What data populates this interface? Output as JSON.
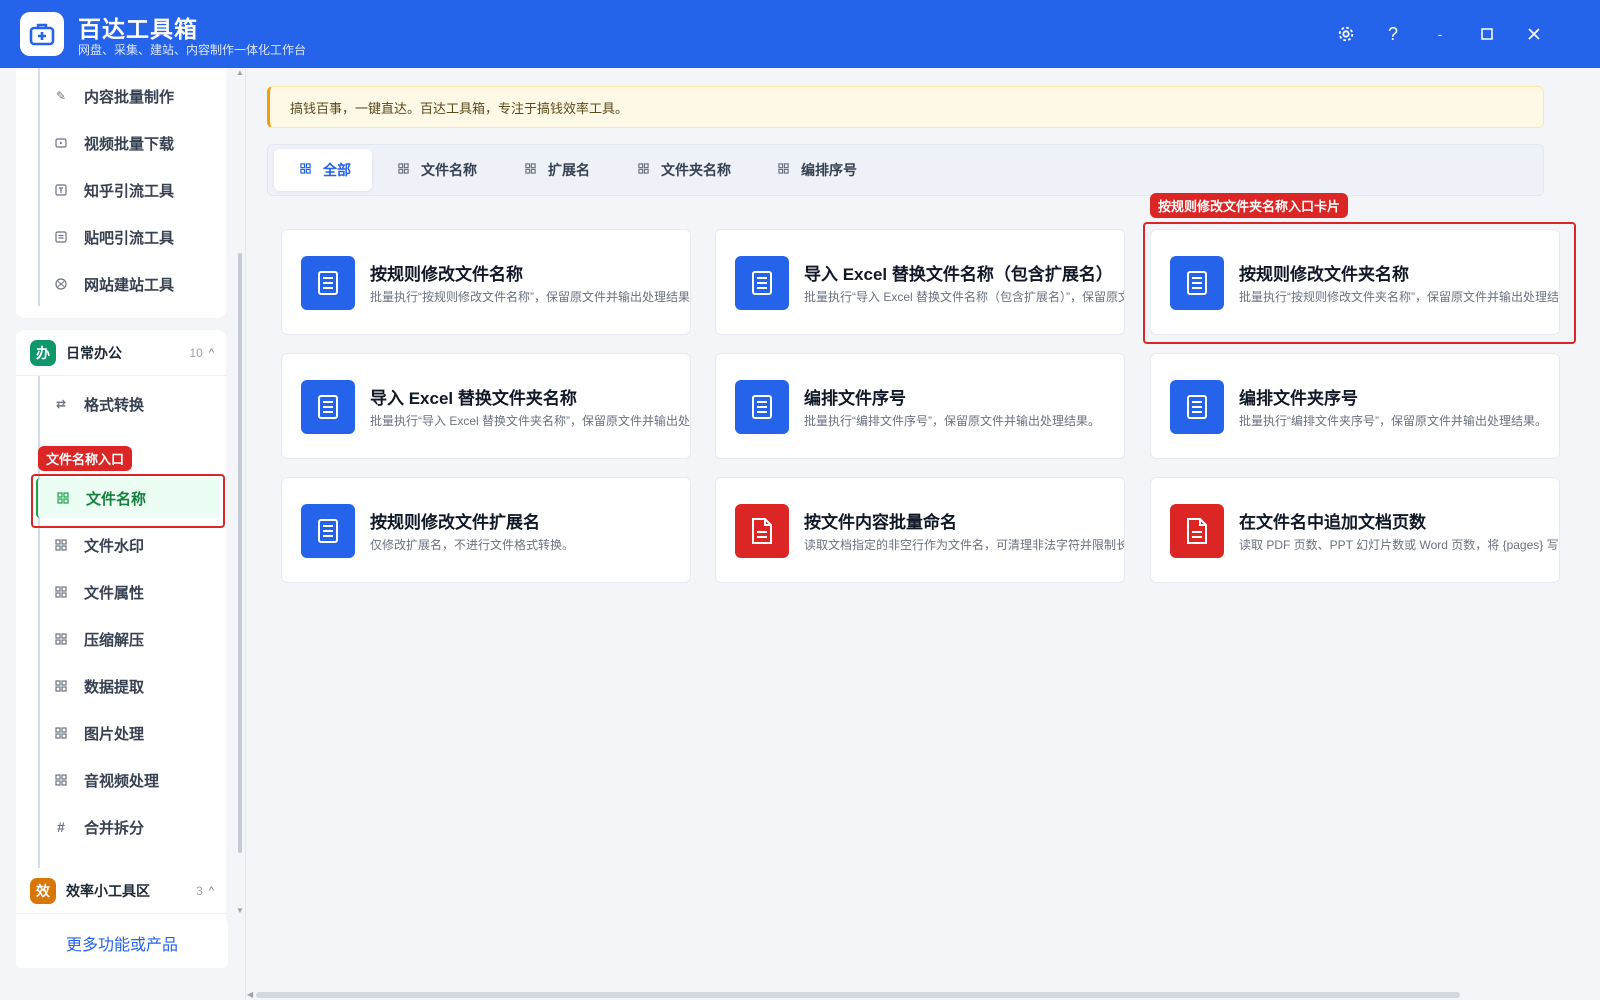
{
  "app": {
    "title": "百达工具箱",
    "subtitle": "网盘、采集、建站、内容制作一体化工作台"
  },
  "window_controls": [
    "settings-icon",
    "help-icon",
    "minimize-icon",
    "maximize-icon",
    "close-icon"
  ],
  "sidebar": {
    "top_items": [
      {
        "label": "内容批量制作",
        "icon": "pencil-icon"
      },
      {
        "label": "视频批量下载",
        "icon": "video-icon"
      },
      {
        "label": "知乎引流工具",
        "icon": "zhihu-icon"
      },
      {
        "label": "贴吧引流工具",
        "icon": "tieba-icon"
      },
      {
        "label": "网站建站工具",
        "icon": "globe-icon"
      }
    ],
    "group_office": {
      "badge": "办",
      "title": "日常办公",
      "count": "10",
      "caret": "^",
      "items": [
        {
          "label": "格式转换",
          "icon": "convert-icon"
        },
        {
          "label": "文件名称",
          "icon": "grid-icon",
          "active": true
        },
        {
          "label": "文件水印",
          "icon": "grid-icon"
        },
        {
          "label": "文件属性",
          "icon": "grid-icon"
        },
        {
          "label": "压缩解压",
          "icon": "grid-icon"
        },
        {
          "label": "数据提取",
          "icon": "grid-icon"
        },
        {
          "label": "图片处理",
          "icon": "grid-icon"
        },
        {
          "label": "音视频处理",
          "icon": "grid-icon"
        },
        {
          "label": "合并拆分",
          "icon": "hash-icon"
        }
      ]
    },
    "group_efficiency": {
      "badge": "效",
      "title": "效率小工具区",
      "count": "3",
      "caret": "^"
    },
    "more_button": "更多功能或产品"
  },
  "annotations": {
    "sidebar_tag": "文件名称入口",
    "card_tag": "按规则修改文件夹名称入口卡片"
  },
  "notice": "搞钱百事，一键直达。百达工具箱，专注于搞钱效率工具。",
  "tabs": [
    "全部",
    "文件名称",
    "扩展名",
    "文件夹名称",
    "编排序号"
  ],
  "tools": [
    {
      "title": "按规则修改文件名称",
      "desc": "批量执行“按规则修改文件名称”，保留原文件并输出处理结果。",
      "color": "blue"
    },
    {
      "title": "导入 Excel 替换文件名称（包含扩展名）",
      "desc": "批量执行“导入 Excel 替换文件名称（包含扩展名）”，保留原文件",
      "color": "blue"
    },
    {
      "title": "按规则修改文件夹名称",
      "desc": "批量执行“按规则修改文件夹名称”，保留原文件并输出处理结果",
      "color": "blue"
    },
    {
      "title": "导入 Excel 替换文件夹名称",
      "desc": "批量执行“导入 Excel 替换文件夹名称”，保留原文件并输出处理结",
      "color": "blue"
    },
    {
      "title": "编排文件序号",
      "desc": "批量执行“编排文件序号”，保留原文件并输出处理结果。",
      "color": "blue"
    },
    {
      "title": "编排文件夹序号",
      "desc": "批量执行“编排文件夹序号”，保留原文件并输出处理结果。",
      "color": "blue"
    },
    {
      "title": "按规则修改文件扩展名",
      "desc": "仅修改扩展名，不进行文件格式转换。",
      "color": "blue"
    },
    {
      "title": "按文件内容批量命名",
      "desc": "读取文档指定的非空行作为文件名，可清理非法字符并限制长度；",
      "color": "red"
    },
    {
      "title": "在文件名中追加文档页数",
      "desc": "读取 PDF 页数、PPT 幻灯片数或 Word 页数，将 {pages} 写入命名",
      "color": "red"
    }
  ],
  "colors": {
    "brand": "#2563eb",
    "active_green": "#16a34a",
    "highlight_red": "#dc2626",
    "badge_office": "#10966b",
    "badge_efficiency": "#d97706"
  }
}
